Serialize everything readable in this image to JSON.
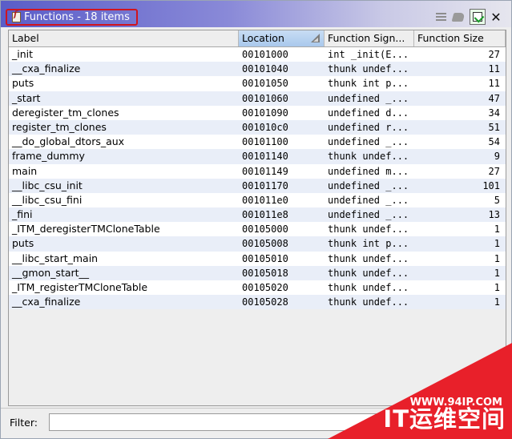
{
  "window": {
    "title": "Functions - 18 items"
  },
  "toolbar": {
    "icons": [
      "list-lines-icon",
      "eraser-icon",
      "refresh-selection-icon",
      "close-icon"
    ],
    "close_glyph": "✕"
  },
  "table": {
    "columns": [
      "Label",
      "Location",
      "Function Sign...",
      "Function Size"
    ],
    "sorted_column": "Location",
    "rows": [
      {
        "label": "_init",
        "location": "00101000",
        "signature": "int _init(E...",
        "size": "27"
      },
      {
        "label": "__cxa_finalize",
        "location": "00101040",
        "signature": "thunk undef...",
        "size": "11"
      },
      {
        "label": "puts",
        "location": "00101050",
        "signature": "thunk int p...",
        "size": "11"
      },
      {
        "label": "_start",
        "location": "00101060",
        "signature": "undefined _...",
        "size": "47"
      },
      {
        "label": "deregister_tm_clones",
        "location": "00101090",
        "signature": "undefined d...",
        "size": "34"
      },
      {
        "label": "register_tm_clones",
        "location": "001010c0",
        "signature": "undefined r...",
        "size": "51"
      },
      {
        "label": "__do_global_dtors_aux",
        "location": "00101100",
        "signature": "undefined _...",
        "size": "54"
      },
      {
        "label": "frame_dummy",
        "location": "00101140",
        "signature": "thunk undef...",
        "size": "9"
      },
      {
        "label": "main",
        "location": "00101149",
        "signature": "undefined m...",
        "size": "27"
      },
      {
        "label": "__libc_csu_init",
        "location": "00101170",
        "signature": "undefined _...",
        "size": "101"
      },
      {
        "label": "__libc_csu_fini",
        "location": "001011e0",
        "signature": "undefined _...",
        "size": "5"
      },
      {
        "label": "_fini",
        "location": "001011e8",
        "signature": "undefined _...",
        "size": "13"
      },
      {
        "label": "_ITM_deregisterTMCloneTable",
        "location": "00105000",
        "signature": "thunk undef...",
        "size": "1"
      },
      {
        "label": "puts",
        "location": "00105008",
        "signature": "thunk int p...",
        "size": "1"
      },
      {
        "label": "__libc_start_main",
        "location": "00105010",
        "signature": "thunk undef...",
        "size": "1"
      },
      {
        "label": "__gmon_start__",
        "location": "00105018",
        "signature": "thunk undef...",
        "size": "1"
      },
      {
        "label": "_ITM_registerTMCloneTable",
        "location": "00105020",
        "signature": "thunk undef...",
        "size": "1"
      },
      {
        "label": "__cxa_finalize",
        "location": "00105028",
        "signature": "thunk undef...",
        "size": "1"
      }
    ]
  },
  "filter": {
    "label": "Filter:",
    "value": "",
    "placeholder": ""
  },
  "watermark": {
    "url": "WWW.94IP.COM",
    "brand": "IT运维空间"
  },
  "colors": {
    "title_gradient_start": "#5a5dc8",
    "title_highlight_border": "#d0141e",
    "sorted_header": "#a9c8ec",
    "alt_row": "#e9eef8",
    "watermark": "#e8202a"
  }
}
